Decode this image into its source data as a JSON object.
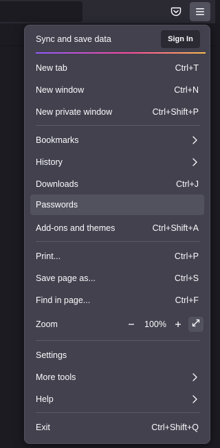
{
  "colors": {
    "panel_bg": "#42414d",
    "hover_bg": "#52525e",
    "text": "#fbfbfe",
    "gradient": [
      "#9059ff",
      "#ff4aa2",
      "#ffbd4f"
    ]
  },
  "toolbar": {
    "pocket_icon": "pocket-icon",
    "menu_icon": "hamburger-menu-icon"
  },
  "sync": {
    "label": "Sync and save data",
    "button": "Sign In"
  },
  "items": {
    "new_tab": {
      "label": "New tab",
      "shortcut": "Ctrl+T"
    },
    "new_window": {
      "label": "New window",
      "shortcut": "Ctrl+N"
    },
    "new_private_window": {
      "label": "New private window",
      "shortcut": "Ctrl+Shift+P"
    },
    "bookmarks": {
      "label": "Bookmarks"
    },
    "history": {
      "label": "History"
    },
    "downloads": {
      "label": "Downloads",
      "shortcut": "Ctrl+J"
    },
    "passwords": {
      "label": "Passwords"
    },
    "addons": {
      "label": "Add-ons and themes",
      "shortcut": "Ctrl+Shift+A"
    },
    "print": {
      "label": "Print...",
      "shortcut": "Ctrl+P"
    },
    "save_page": {
      "label": "Save page as...",
      "shortcut": "Ctrl+S"
    },
    "find_in_page": {
      "label": "Find in page...",
      "shortcut": "Ctrl+F"
    },
    "zoom": {
      "label": "Zoom",
      "minus": "−",
      "value": "100%",
      "plus": "+"
    },
    "settings": {
      "label": "Settings"
    },
    "more_tools": {
      "label": "More tools"
    },
    "help": {
      "label": "Help"
    },
    "exit": {
      "label": "Exit",
      "shortcut": "Ctrl+Shift+Q"
    }
  }
}
